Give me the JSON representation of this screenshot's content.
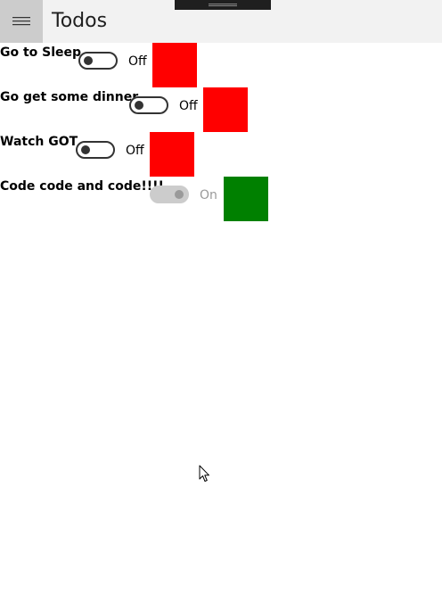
{
  "app": {
    "title": "Todos",
    "menu_icon": "hamburger-icon"
  },
  "todos": [
    {
      "title": "Go to Sleep",
      "state_label": "Off",
      "is_on": false,
      "status_color": "#ff0000"
    },
    {
      "title": "Go get some dinner",
      "state_label": "Off",
      "is_on": false,
      "status_color": "#ff0000"
    },
    {
      "title": "Watch GOT",
      "state_label": "Off",
      "is_on": false,
      "status_color": "#ff0000"
    },
    {
      "title": "Code code and code!!!!",
      "state_label": "On",
      "is_on": true,
      "status_color": "#008000"
    }
  ],
  "colors": {
    "titlebar_bg": "#f2f2f2",
    "hamburger_bg": "#cccccc",
    "off_color": "#ff0000",
    "on_color": "#008000"
  }
}
